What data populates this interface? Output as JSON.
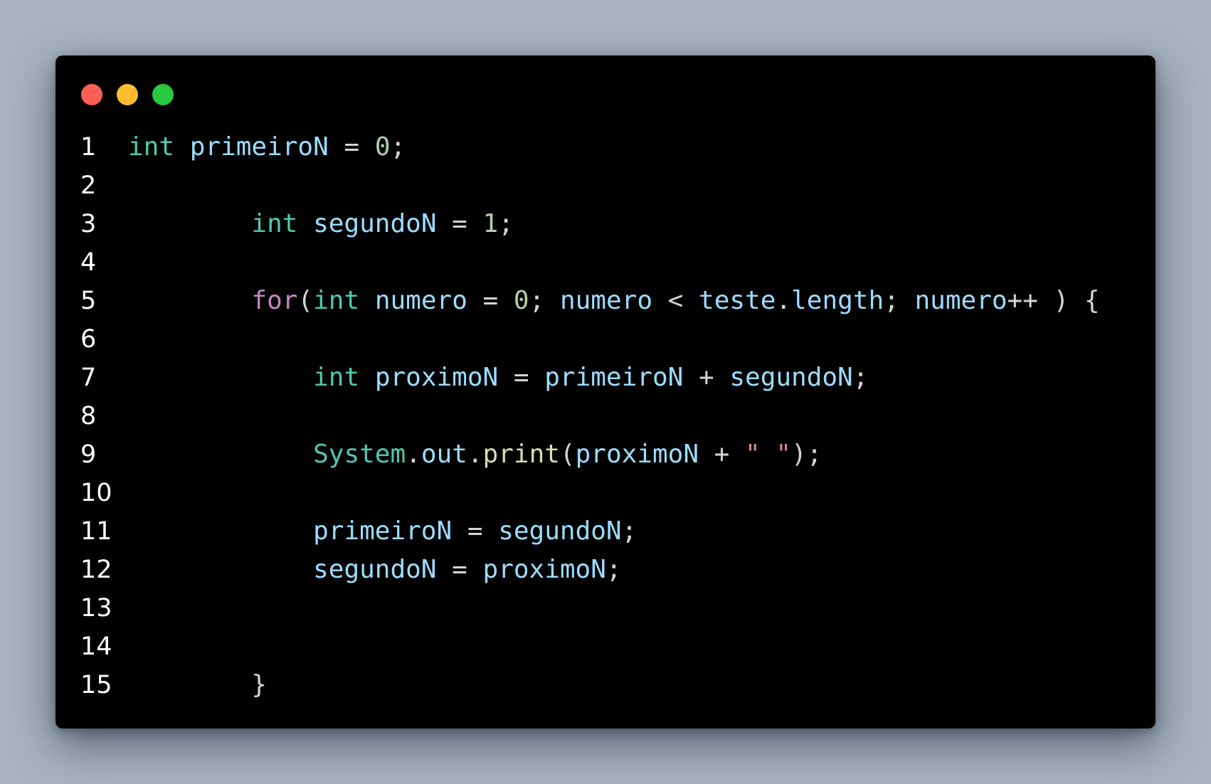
{
  "window_controls": [
    {
      "name": "close",
      "color": "#ff5f57"
    },
    {
      "name": "minimize",
      "color": "#febc2e"
    },
    {
      "name": "maximize",
      "color": "#28c840"
    }
  ],
  "colors": {
    "background": "#a8b3bf",
    "editor_background": "#000000",
    "line_number": "#ffffff",
    "keyword_type": "#4ec9b0",
    "control_keyword": "#c586c0",
    "variable": "#9cdcfe",
    "number": "#b5cea8",
    "function": "#dcdcaa",
    "string": "#ce9178",
    "punctuation": "#d4d4d4"
  },
  "lines": [
    {
      "number": "1",
      "tokens": [
        {
          "text": "int",
          "kind": "type"
        },
        {
          "text": " ",
          "kind": "plain"
        },
        {
          "text": "primeiroN",
          "kind": "var"
        },
        {
          "text": " = ",
          "kind": "plain"
        },
        {
          "text": "0",
          "kind": "num"
        },
        {
          "text": ";",
          "kind": "plain"
        }
      ]
    },
    {
      "number": "2",
      "tokens": []
    },
    {
      "number": "3",
      "tokens": [
        {
          "text": "        ",
          "kind": "plain"
        },
        {
          "text": "int",
          "kind": "type"
        },
        {
          "text": " ",
          "kind": "plain"
        },
        {
          "text": "segundoN",
          "kind": "var"
        },
        {
          "text": " = ",
          "kind": "plain"
        },
        {
          "text": "1",
          "kind": "num"
        },
        {
          "text": ";",
          "kind": "plain"
        }
      ]
    },
    {
      "number": "4",
      "tokens": []
    },
    {
      "number": "5",
      "tokens": [
        {
          "text": "        ",
          "kind": "plain"
        },
        {
          "text": "for",
          "kind": "ctrl"
        },
        {
          "text": "(",
          "kind": "plain"
        },
        {
          "text": "int",
          "kind": "type"
        },
        {
          "text": " ",
          "kind": "plain"
        },
        {
          "text": "numero",
          "kind": "var"
        },
        {
          "text": " = ",
          "kind": "plain"
        },
        {
          "text": "0",
          "kind": "num"
        },
        {
          "text": "; ",
          "kind": "plain"
        },
        {
          "text": "numero",
          "kind": "var"
        },
        {
          "text": " < ",
          "kind": "plain"
        },
        {
          "text": "teste",
          "kind": "var"
        },
        {
          "text": ".",
          "kind": "plain"
        },
        {
          "text": "length",
          "kind": "var"
        },
        {
          "text": "; ",
          "kind": "plain"
        },
        {
          "text": "numero",
          "kind": "var"
        },
        {
          "text": "++ ) {",
          "kind": "plain"
        }
      ]
    },
    {
      "number": "6",
      "tokens": []
    },
    {
      "number": "7",
      "tokens": [
        {
          "text": "            ",
          "kind": "plain"
        },
        {
          "text": "int",
          "kind": "type"
        },
        {
          "text": " ",
          "kind": "plain"
        },
        {
          "text": "proximoN",
          "kind": "var"
        },
        {
          "text": " = ",
          "kind": "plain"
        },
        {
          "text": "primeiroN",
          "kind": "var"
        },
        {
          "text": " + ",
          "kind": "plain"
        },
        {
          "text": "segundoN",
          "kind": "var"
        },
        {
          "text": ";",
          "kind": "plain"
        }
      ]
    },
    {
      "number": "8",
      "tokens": []
    },
    {
      "number": "9",
      "tokens": [
        {
          "text": "            ",
          "kind": "plain"
        },
        {
          "text": "System",
          "kind": "type"
        },
        {
          "text": ".",
          "kind": "plain"
        },
        {
          "text": "out",
          "kind": "var"
        },
        {
          "text": ".",
          "kind": "plain"
        },
        {
          "text": "print",
          "kind": "func"
        },
        {
          "text": "(",
          "kind": "plain"
        },
        {
          "text": "proximoN",
          "kind": "var"
        },
        {
          "text": " + ",
          "kind": "plain"
        },
        {
          "text": "\" \"",
          "kind": "str"
        },
        {
          "text": ");",
          "kind": "plain"
        }
      ]
    },
    {
      "number": "10",
      "tokens": []
    },
    {
      "number": "11",
      "tokens": [
        {
          "text": "            ",
          "kind": "plain"
        },
        {
          "text": "primeiroN",
          "kind": "var"
        },
        {
          "text": " = ",
          "kind": "plain"
        },
        {
          "text": "segundoN",
          "kind": "var"
        },
        {
          "text": ";",
          "kind": "plain"
        }
      ]
    },
    {
      "number": "12",
      "tokens": [
        {
          "text": "            ",
          "kind": "plain"
        },
        {
          "text": "segundoN",
          "kind": "var"
        },
        {
          "text": " = ",
          "kind": "plain"
        },
        {
          "text": "proximoN",
          "kind": "var"
        },
        {
          "text": ";",
          "kind": "plain"
        }
      ]
    },
    {
      "number": "13",
      "tokens": []
    },
    {
      "number": "14",
      "tokens": []
    },
    {
      "number": "15",
      "tokens": [
        {
          "text": "        ",
          "kind": "plain"
        },
        {
          "text": "}",
          "kind": "plain"
        }
      ]
    }
  ]
}
